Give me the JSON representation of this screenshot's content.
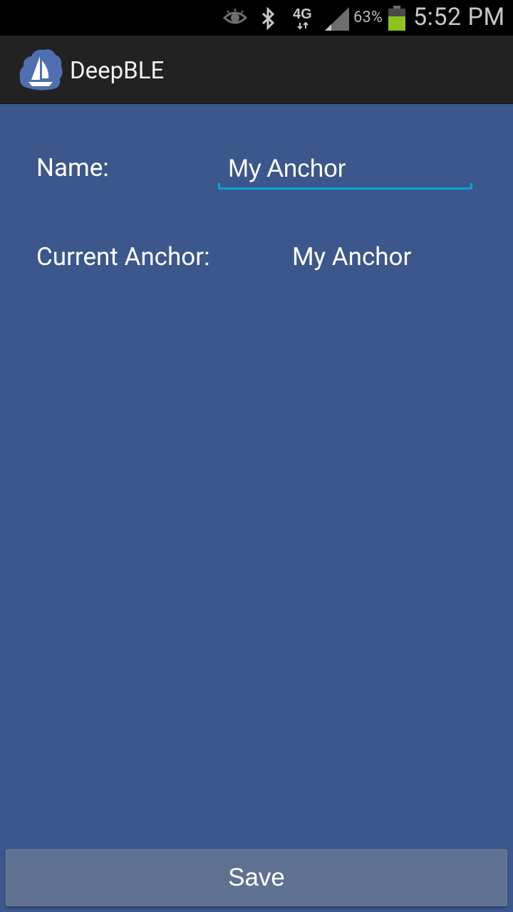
{
  "status_bar": {
    "icons": [
      "eye-icon",
      "bluetooth-icon",
      "4g-icon",
      "signal-icon",
      "battery-icon"
    ],
    "network_label": "4G",
    "battery_percent": "63%",
    "battery_level": 0.63,
    "time": "5:52 PM"
  },
  "action_bar": {
    "title": "DeepBLE",
    "icon": "sailboat-icon"
  },
  "form": {
    "name_label": "Name:",
    "name_value": "My Anchor",
    "current_anchor_label": "Current Anchor:",
    "current_anchor_value": "My Anchor"
  },
  "footer": {
    "save_label": "Save"
  },
  "colors": {
    "background": "#3b578b",
    "action_bar": "#222222",
    "status_bar": "#000000",
    "accent": "#0aa3d6",
    "button": "#5f7190",
    "battery_fill": "#8ec21f"
  }
}
